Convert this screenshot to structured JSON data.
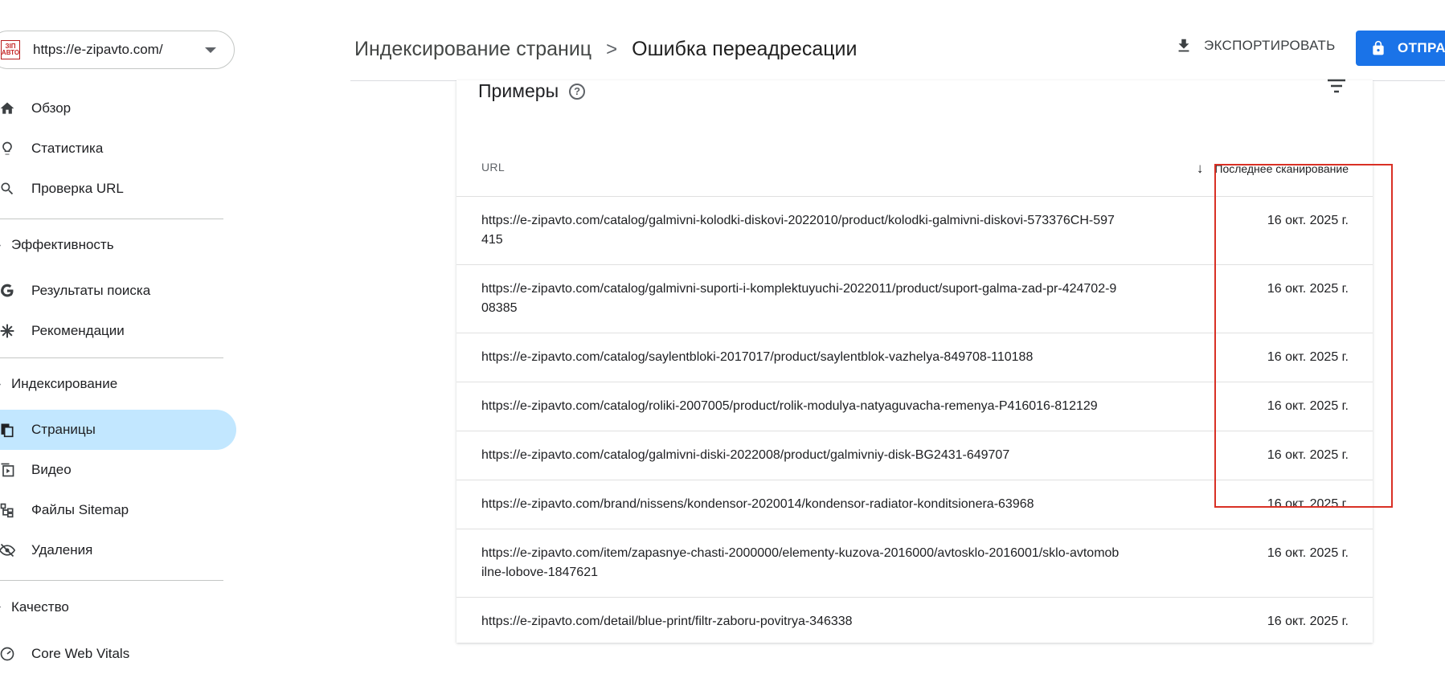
{
  "property": {
    "url": "https://e-zipavto.com/",
    "logo_text": "ЗІП АВТО"
  },
  "sidebar": {
    "groups": [
      {
        "items": [
          {
            "label": "Обзор",
            "icon": "home-icon"
          },
          {
            "label": "Статистика",
            "icon": "lightbulb-icon"
          },
          {
            "label": "Проверка URL",
            "icon": "search-icon"
          }
        ]
      },
      {
        "section": "Эффективность",
        "items": [
          {
            "label": "Результаты поиска",
            "icon": "google-g-icon"
          },
          {
            "label": "Рекомендации",
            "icon": "asterisk-icon"
          }
        ]
      },
      {
        "section": "Индексирование",
        "items": [
          {
            "label": "Страницы",
            "icon": "pages-icon",
            "active": true
          },
          {
            "label": "Видео",
            "icon": "video-icon"
          },
          {
            "label": "Файлы Sitemap",
            "icon": "sitemap-icon"
          },
          {
            "label": "Удаления",
            "icon": "eye-off-icon"
          }
        ]
      },
      {
        "section": "Качество",
        "items": [
          {
            "label": "Core Web Vitals",
            "icon": "gauge-icon"
          }
        ]
      }
    ]
  },
  "header": {
    "breadcrumb_parent": "Индексирование страниц",
    "breadcrumb_separator": ">",
    "breadcrumb_current": "Ошибка переадресации",
    "export_label": "ЭКСПОРТИРОВАТЬ",
    "submit_label": "ОТПРА"
  },
  "examples": {
    "title": "Примеры",
    "columns": {
      "url": "URL",
      "last_crawl": "Последнее сканирование"
    },
    "rows": [
      {
        "url": "https://e-zipavto.com/catalog/galmivni-kolodki-diskovi-2022010/product/kolodki-galmivni-diskovi-573376CH-597415",
        "date": "16 окт. 2025 г."
      },
      {
        "url": "https://e-zipavto.com/catalog/galmivni-suporti-i-komplektuyuchi-2022011/product/suport-galma-zad-pr-424702-908385",
        "date": "16 окт. 2025 г."
      },
      {
        "url": "https://e-zipavto.com/catalog/saylentbloki-2017017/product/saylentblok-vazhelya-849708-110188",
        "date": "16 окт. 2025 г."
      },
      {
        "url": "https://e-zipavto.com/catalog/roliki-2007005/product/rolik-modulya-natyaguvacha-remenya-P416016-812129",
        "date": "16 окт. 2025 г."
      },
      {
        "url": "https://e-zipavto.com/catalog/galmivni-diski-2022008/product/galmivniy-disk-BG2431-649707",
        "date": "16 окт. 2025 г."
      },
      {
        "url": "https://e-zipavto.com/brand/nissens/kondensor-2020014/kondensor-radiator-konditsionera-63968",
        "date": "16 окт. 2025 г."
      },
      {
        "url": "https://e-zipavto.com/item/zapasnye-chasti-2000000/elementy-kuzova-2016000/avtosklo-2016001/sklo-avtomobilne-lobove-1847621",
        "date": "16 окт. 2025 г."
      },
      {
        "url": "https://e-zipavto.com/detail/blue-print/filtr-zaboru-povitrya-346338",
        "date": "16 окт. 2025 г."
      }
    ]
  },
  "colors": {
    "accent": "#1a73e8",
    "active_nav": "#c2e7ff",
    "highlight_box": "#d93025"
  }
}
